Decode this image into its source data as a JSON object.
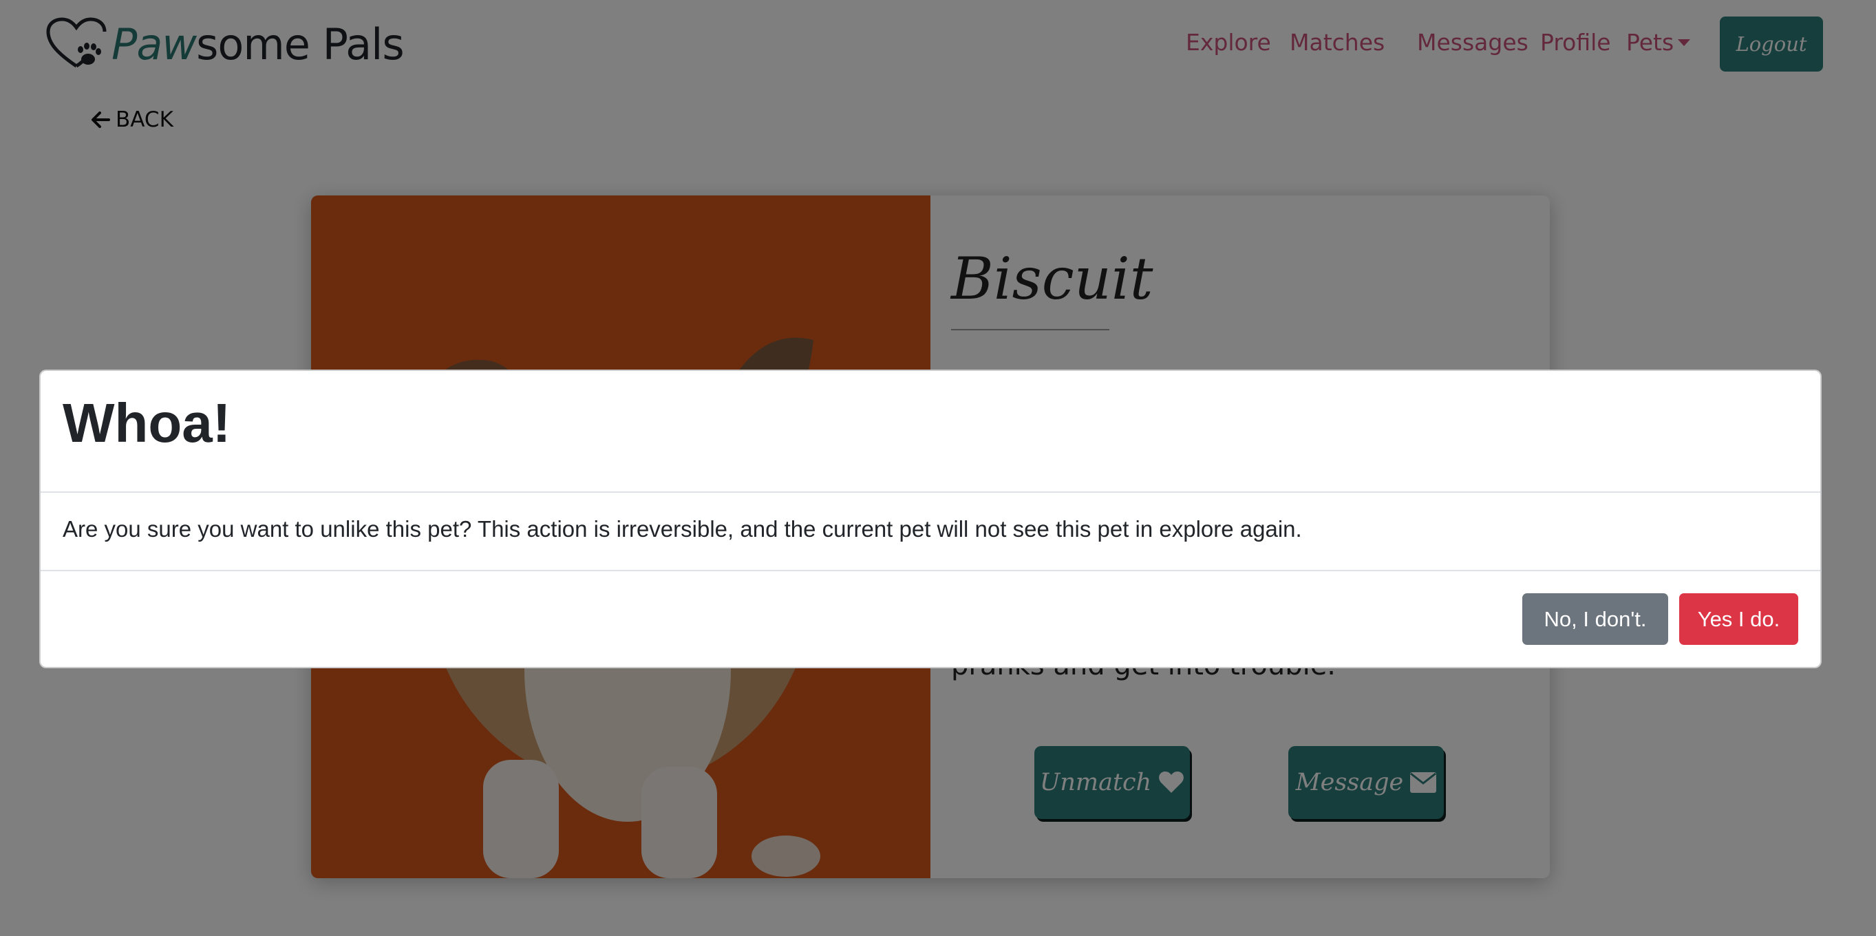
{
  "navbar": {
    "brand": {
      "name_accent": "Paw",
      "name_rest": "some Pals"
    },
    "links": [
      {
        "label": "Explore"
      },
      {
        "label": "Matches"
      },
      {
        "label": "Messages"
      },
      {
        "label": "Profile"
      },
      {
        "label": "Pets"
      }
    ],
    "logout_label": "Logout"
  },
  "back": {
    "label": "BACK",
    "icon": "arrow-left-icon"
  },
  "pet": {
    "name": "Biscuit",
    "bio_visible": "pranks and get into trouble.",
    "unmatch_label": "Unmatch",
    "unmatch_icon": "broken-heart-icon",
    "message_label": "Message",
    "message_icon": "envelope-icon"
  },
  "modal": {
    "title": "Whoa!",
    "body": "Are you sure you want to unlike this pet? This action is irreversible, and the current pet will not see this pet in explore again.",
    "no_label": "No, I don't.",
    "yes_label": "Yes I do."
  },
  "colors": {
    "brand_teal": "#2c7d7b",
    "nav_link": "#c9517a",
    "danger": "#dc3545",
    "secondary": "#6c757d",
    "photo_bg": "#e0601e"
  }
}
